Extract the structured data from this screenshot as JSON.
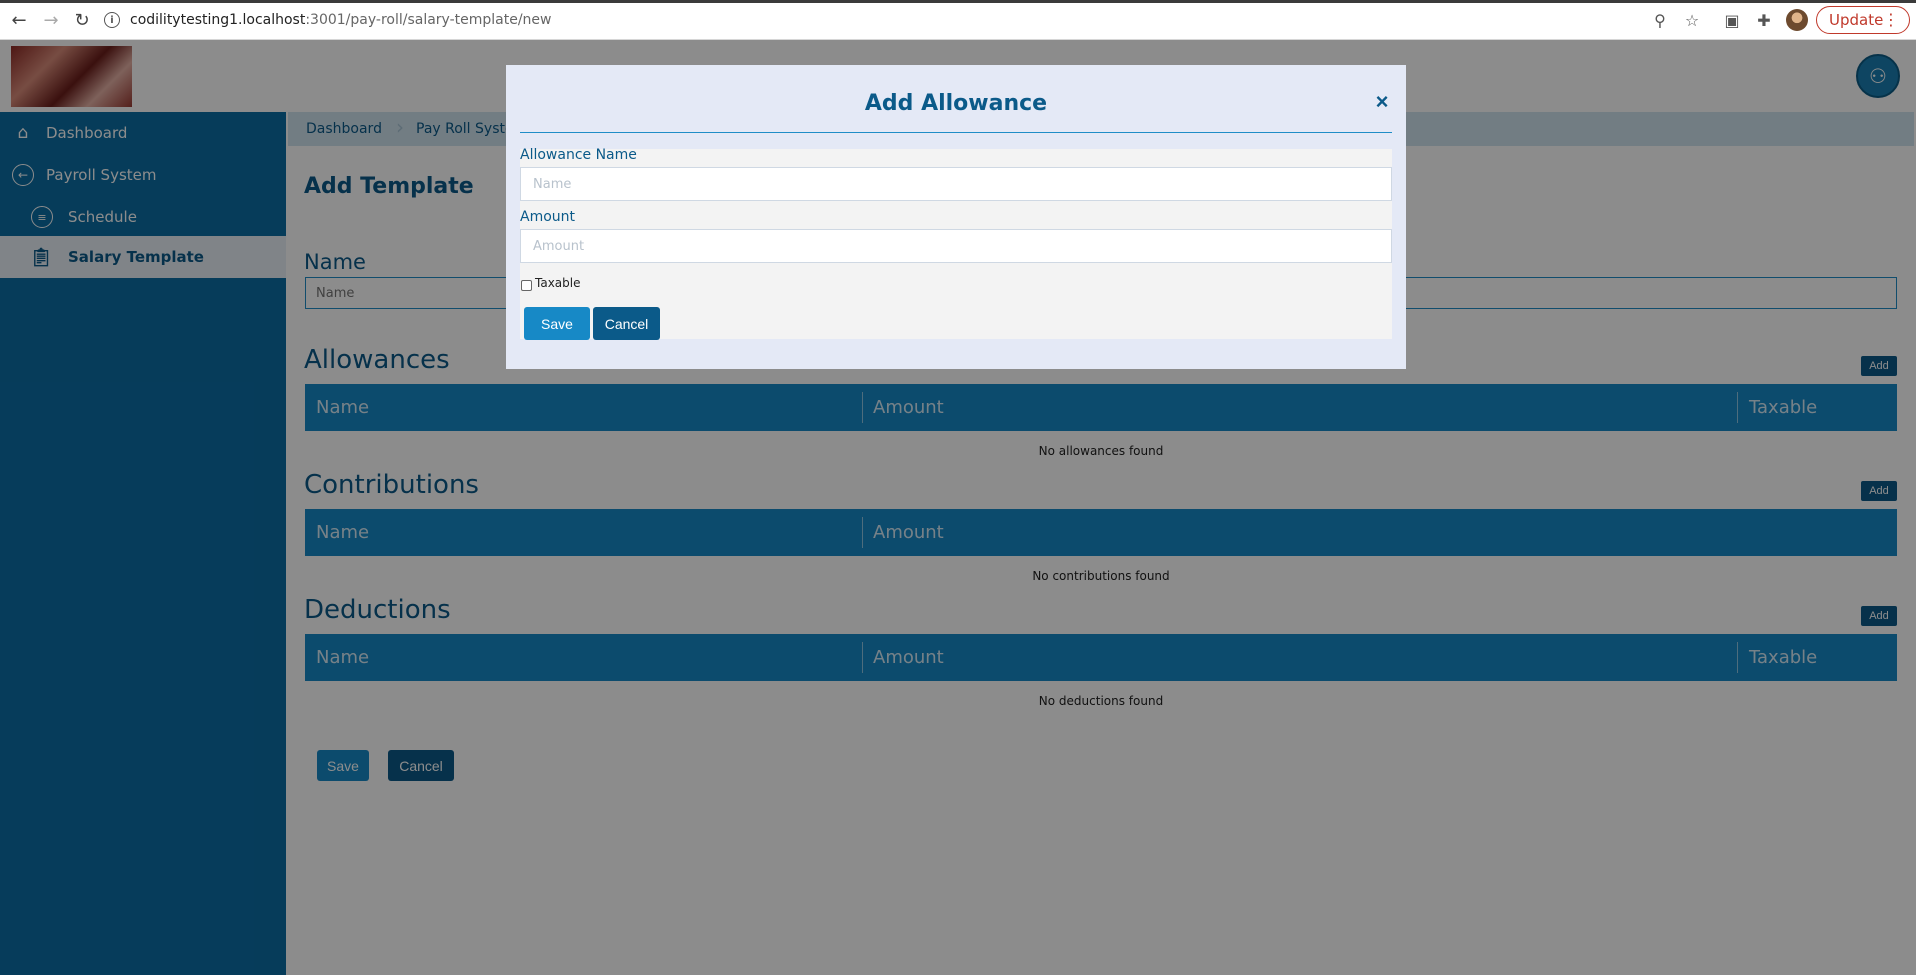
{
  "browser": {
    "url_host": "codilitytesting1.localhost",
    "url_path": ":3001/pay-roll/salary-template/new",
    "update_label": "Update"
  },
  "sidebar": {
    "items": [
      {
        "label": "Dashboard",
        "icon": "home-icon"
      },
      {
        "label": "Payroll System",
        "icon": "back-arrow-icon"
      },
      {
        "label": "Schedule",
        "icon": "list-icon"
      },
      {
        "label": "Salary Template",
        "icon": "clipboard-icon",
        "active": true
      }
    ]
  },
  "breadcrumb": [
    "Dashboard",
    "Pay Roll System"
  ],
  "page": {
    "title": "Add Template",
    "name_label": "Name",
    "name_placeholder": "Name"
  },
  "sections": {
    "allowances": {
      "title": "Allowances",
      "add_label": "Add",
      "columns": [
        "Name",
        "Amount",
        "Taxable"
      ],
      "empty": "No allowances found"
    },
    "contributions": {
      "title": "Contributions",
      "add_label": "Add",
      "columns": [
        "Name",
        "Amount"
      ],
      "empty": "No contributions found"
    },
    "deductions": {
      "title": "Deductions",
      "add_label": "Add",
      "columns": [
        "Name",
        "Amount",
        "Taxable"
      ],
      "empty": "No deductions found"
    }
  },
  "footer": {
    "save_label": "Save",
    "cancel_label": "Cancel"
  },
  "modal": {
    "title": "Add Allowance",
    "close_glyph": "×",
    "allowance_name_label": "Allowance Name",
    "allowance_name_placeholder": "Name",
    "amount_label": "Amount",
    "amount_placeholder": "Amount",
    "taxable_label": "Taxable",
    "taxable_checked": false,
    "save_label": "Save",
    "cancel_label": "Cancel"
  },
  "colors": {
    "primary": "#1789c6",
    "dark": "#0b5a89",
    "sidebar": "#0b6ea5"
  }
}
